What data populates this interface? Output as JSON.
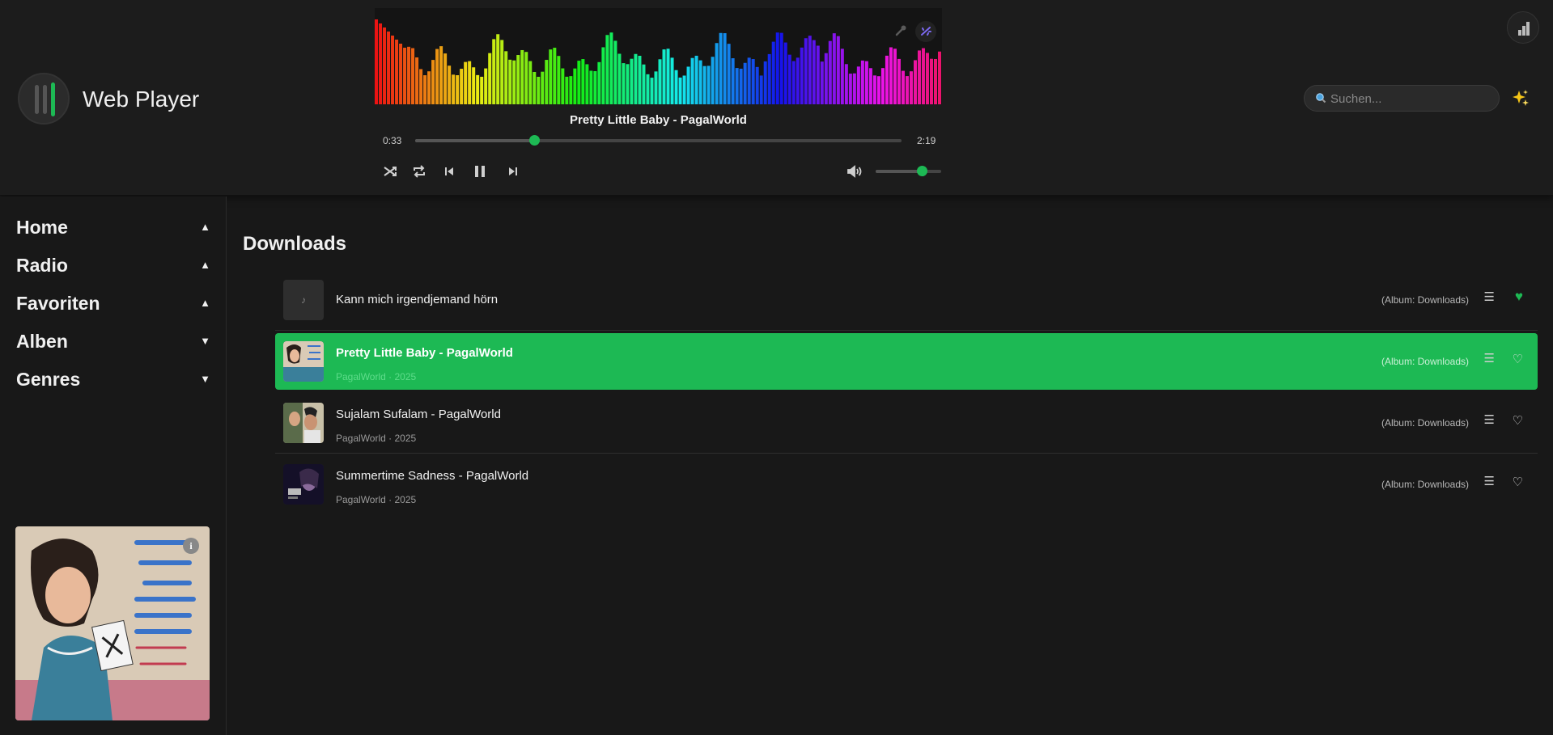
{
  "app": {
    "title": "Web Player"
  },
  "player": {
    "now_playing": "Pretty Little Baby - PagalWorld",
    "current_time": "0:33",
    "total_time": "2:19",
    "progress": 0.245,
    "volume": 0.7,
    "accent": "#1db954"
  },
  "search": {
    "placeholder": "Suchen..."
  },
  "sidebar": {
    "items": [
      {
        "label": "Home",
        "arrow": "▲"
      },
      {
        "label": "Radio",
        "arrow": "▲"
      },
      {
        "label": "Favoriten",
        "arrow": "▲"
      },
      {
        "label": "Alben",
        "arrow": "▼"
      },
      {
        "label": "Genres",
        "arrow": "▼"
      }
    ],
    "info_glyph": "i"
  },
  "main": {
    "section_title": "Downloads",
    "tracks": [
      {
        "title": "Kann mich irgendjemand hörn",
        "subtitle": "",
        "album": "(Album: Downloads)",
        "liked": true,
        "active": false
      },
      {
        "title": "Pretty Little Baby - PagalWorld",
        "subtitle": "PagalWorld · 2025",
        "album": "(Album: Downloads)",
        "liked": false,
        "active": true
      },
      {
        "title": "Sujalam Sufalam - PagalWorld",
        "subtitle": "PagalWorld · 2025",
        "album": "(Album: Downloads)",
        "liked": false,
        "active": false
      },
      {
        "title": "Summertime Sadness - PagalWorld",
        "subtitle": "PagalWorld · 2025",
        "album": "(Album: Downloads)",
        "liked": false,
        "active": false
      }
    ]
  },
  "icons": {
    "shuffle": "shuffle-icon",
    "repeat": "repeat-icon",
    "previous": "skip-previous-icon",
    "pause": "pause-icon",
    "next": "skip-next-icon",
    "volume": "volume-icon",
    "stats": "bar-chart-icon",
    "search": "search-icon",
    "sparkle": "sparkles-icon",
    "queue": "queue-list-icon",
    "heart": "heart-icon"
  }
}
